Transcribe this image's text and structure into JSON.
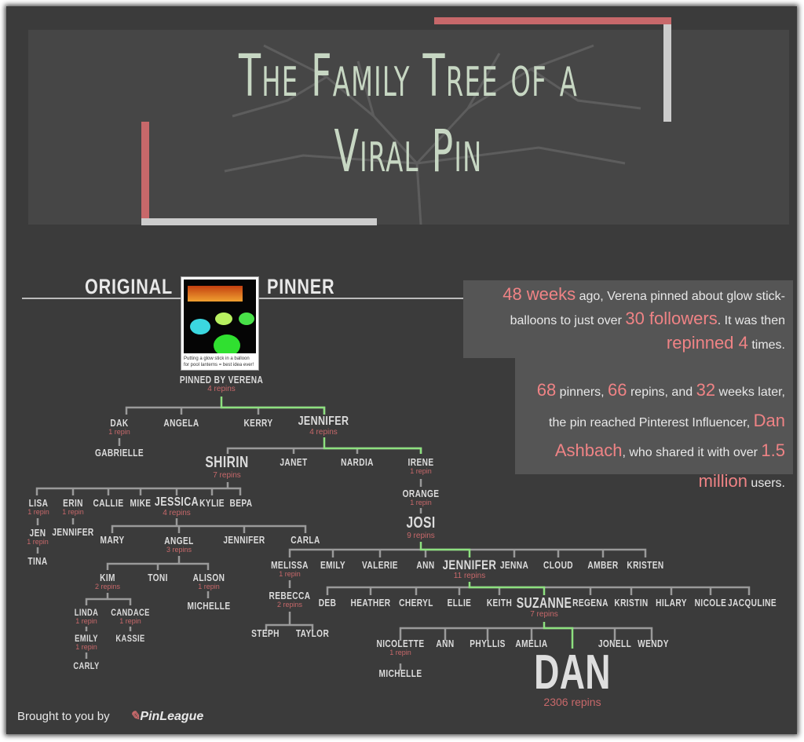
{
  "title": {
    "line1": "The Family Tree of a",
    "line2": "Viral Pin"
  },
  "original_pinner": {
    "left": "ORIGINAL",
    "right": "PINNER",
    "pin_caption": "Putting a glow stick in a balloon for pool lanterns = best idea ever!",
    "pinned_by": "PINNED BY VERENA",
    "repins": "4 repins"
  },
  "stats": {
    "p1": {
      "a": "48 weeks",
      "b": " ago, Verena pinned about glow stick-balloons to just over ",
      "c": "30 followers",
      "d": ". It was then ",
      "e": "repinned 4",
      "f": " times."
    },
    "p2": {
      "a": "68",
      "b": " pinners, ",
      "c": "66",
      "d": " repins, and ",
      "e": "32",
      "f": " weeks later, the pin reached Pinterest Influencer, ",
      "g": "Dan Ashbach",
      "h": ", who shared it with over ",
      "i": "1.5 million",
      "j": " users."
    }
  },
  "colors": {
    "background": "#3b3b3b",
    "accent_red": "#c7686a",
    "viral_path_green": "#8de07f",
    "title": "#c7d7c3"
  },
  "tree": {
    "nodes": [
      {
        "name": "DAK",
        "repins": "1 repin"
      },
      {
        "name": "GABRIELLE"
      },
      {
        "name": "ANGELA"
      },
      {
        "name": "KERRY"
      },
      {
        "name": "JENNIFER",
        "repins": "4 repins"
      },
      {
        "name": "SHIRIN",
        "repins": "7 repins"
      },
      {
        "name": "JANET"
      },
      {
        "name": "NARDIA"
      },
      {
        "name": "IRENE",
        "repins": "1 repin"
      },
      {
        "name": "ORANGE",
        "repins": "1 repin"
      },
      {
        "name": "JOSI",
        "repins": "9 repins"
      },
      {
        "name": "LISA",
        "repins": "1 repin"
      },
      {
        "name": "ERIN",
        "repins": "1 repin"
      },
      {
        "name": "CALLIE"
      },
      {
        "name": "MIKE"
      },
      {
        "name": "JESSICA",
        "repins": "4 repins"
      },
      {
        "name": "KYLIE"
      },
      {
        "name": "BEPA"
      },
      {
        "name": "JEN",
        "repins": "1 repin"
      },
      {
        "name": "TINA"
      },
      {
        "name": "JENNIFER"
      },
      {
        "name": "MARY"
      },
      {
        "name": "ANGEL",
        "repins": "3 repins"
      },
      {
        "name": "JENNIFER"
      },
      {
        "name": "CARLA"
      },
      {
        "name": "KIM",
        "repins": "2 repins"
      },
      {
        "name": "TONI"
      },
      {
        "name": "ALISON",
        "repins": "1 repin"
      },
      {
        "name": "MICHELLE"
      },
      {
        "name": "LINDA",
        "repins": "1 repin"
      },
      {
        "name": "CANDACE",
        "repins": "1 repin"
      },
      {
        "name": "EMILY",
        "repins": "1 repin"
      },
      {
        "name": "KASSIE"
      },
      {
        "name": "CARLY"
      },
      {
        "name": "MELISSA",
        "repins": "1 repin"
      },
      {
        "name": "EMILY"
      },
      {
        "name": "VALERIE"
      },
      {
        "name": "ANN"
      },
      {
        "name": "JENNIFER",
        "repins": "11 repins"
      },
      {
        "name": "JENNA"
      },
      {
        "name": "CLOUD"
      },
      {
        "name": "AMBER"
      },
      {
        "name": "KRISTEN"
      },
      {
        "name": "REBECCA",
        "repins": "2 repins"
      },
      {
        "name": "STEPH"
      },
      {
        "name": "TAYLOR"
      },
      {
        "name": "DEB"
      },
      {
        "name": "HEATHER"
      },
      {
        "name": "CHERYL"
      },
      {
        "name": "ELLIE"
      },
      {
        "name": "KEITH"
      },
      {
        "name": "SUZANNE",
        "repins": "7 repins"
      },
      {
        "name": "REGENA"
      },
      {
        "name": "KRISTIN"
      },
      {
        "name": "HILARY"
      },
      {
        "name": "NICOLE"
      },
      {
        "name": "JACQULINE"
      },
      {
        "name": "NICOLETTE",
        "repins": "1 repin"
      },
      {
        "name": "ANN"
      },
      {
        "name": "PHYLLIS"
      },
      {
        "name": "AMELIA"
      },
      {
        "name": "JONELL"
      },
      {
        "name": "WENDY"
      },
      {
        "name": "MICHELLE"
      },
      {
        "name": "DAN",
        "repins": "2306 repins"
      }
    ]
  },
  "footer": {
    "text": "Brought to you by",
    "logo": "PinLeague"
  }
}
